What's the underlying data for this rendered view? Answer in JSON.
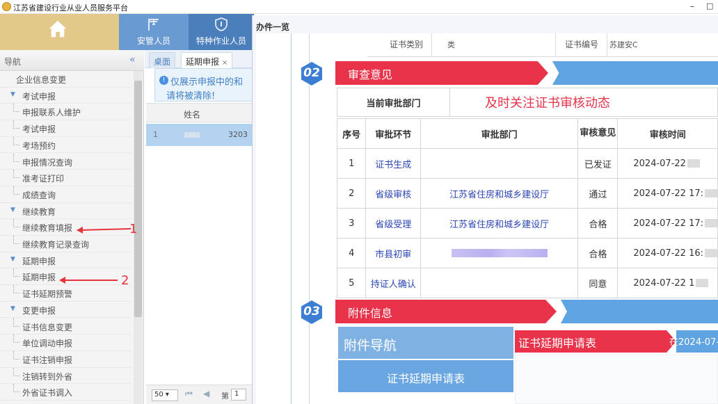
{
  "window": {
    "title": "江苏省建设行业从业人员服务平台",
    "minimize": "–",
    "maximize": "□"
  },
  "topnav": [
    {
      "label": ""
    },
    {
      "label": "安管人员"
    },
    {
      "label": "特种作业人员"
    }
  ],
  "sidebar": {
    "title": "导航",
    "collapse_icon": "«",
    "items": [
      {
        "label": "企业信息变更",
        "type": "leaf0"
      },
      {
        "label": "考试申报",
        "type": "group"
      },
      {
        "label": "申报联系人维护",
        "type": "leaf"
      },
      {
        "label": "考试申报",
        "type": "leaf"
      },
      {
        "label": "考场预约",
        "type": "leaf"
      },
      {
        "label": "申报情况查询",
        "type": "leaf"
      },
      {
        "label": "准考证打印",
        "type": "leaf"
      },
      {
        "label": "成绩查询",
        "type": "leaf"
      },
      {
        "label": "继续教育",
        "type": "group"
      },
      {
        "label": "继续教育填报",
        "type": "leaf"
      },
      {
        "label": "继续教育记录查询",
        "type": "leaf"
      },
      {
        "label": "延期申报",
        "type": "group"
      },
      {
        "label": "延期申报",
        "type": "leaf"
      },
      {
        "label": "证书延期预警",
        "type": "leaf"
      },
      {
        "label": "变更申报",
        "type": "group"
      },
      {
        "label": "证书信息变更",
        "type": "leaf"
      },
      {
        "label": "单位调动申报",
        "type": "leaf"
      },
      {
        "label": "证书注销申报",
        "type": "leaf"
      },
      {
        "label": "注销转到外省",
        "type": "leaf"
      },
      {
        "label": "外省证书调入",
        "type": "leaf"
      }
    ]
  },
  "annotations": {
    "one": "1",
    "two": "2"
  },
  "tabs": [
    {
      "label": "桌面"
    },
    {
      "label": "延期申报",
      "close": "×"
    }
  ],
  "notice": {
    "line1": "仅展示申报中的和",
    "line2": "请将被清除!"
  },
  "grid": {
    "col_name": "姓名",
    "row_num": "1",
    "row_value": "3203"
  },
  "pager": {
    "page_size": "50 ▾",
    "page_label": "第",
    "page_value": "1"
  },
  "modal": {
    "title": "办件一览",
    "info": {
      "k1": "证书类别",
      "v1": "类",
      "k2": "证书编号",
      "v2": "苏建安C"
    },
    "section2": {
      "badge": "02",
      "title": "审查意见"
    },
    "dept_label": "当前审批部门",
    "dept_value": "及时关注证书审核动态",
    "table": {
      "headers": [
        "序号",
        "审批环节",
        "审批部门",
        "审核意见",
        "审核时间"
      ],
      "rows": [
        {
          "no": "1",
          "step": "证书生成",
          "dept": "",
          "opinion": "已发证",
          "time": "2024-07-22"
        },
        {
          "no": "2",
          "step": "省级审核",
          "dept": "江苏省住房和城乡建设厅",
          "opinion": "通过",
          "time": "2024-07-22 17:"
        },
        {
          "no": "3",
          "step": "省级受理",
          "dept": "江苏省住房和城乡建设厅",
          "opinion": "合格",
          "time": "2024-07-22 17:"
        },
        {
          "no": "4",
          "step": "市县初审",
          "dept": "",
          "opinion": "合格",
          "time": "2024-07-22 16:"
        },
        {
          "no": "5",
          "step": "持证人确认",
          "dept": "",
          "opinion": "同意",
          "time": "2024-07-22 1"
        }
      ]
    },
    "section3": {
      "badge": "03",
      "title": "附件信息"
    },
    "attach_nav": "附件导航",
    "attach_nav_item": "证书延期申请表",
    "attach_title": "证书延期申请表",
    "attach_date": "在2024-07-"
  },
  "colors": {
    "accent_red": "#e8334a",
    "accent_blue": "#5fa3e0",
    "nav_blue": "#4a7fbc",
    "link": "#2b45b5"
  }
}
